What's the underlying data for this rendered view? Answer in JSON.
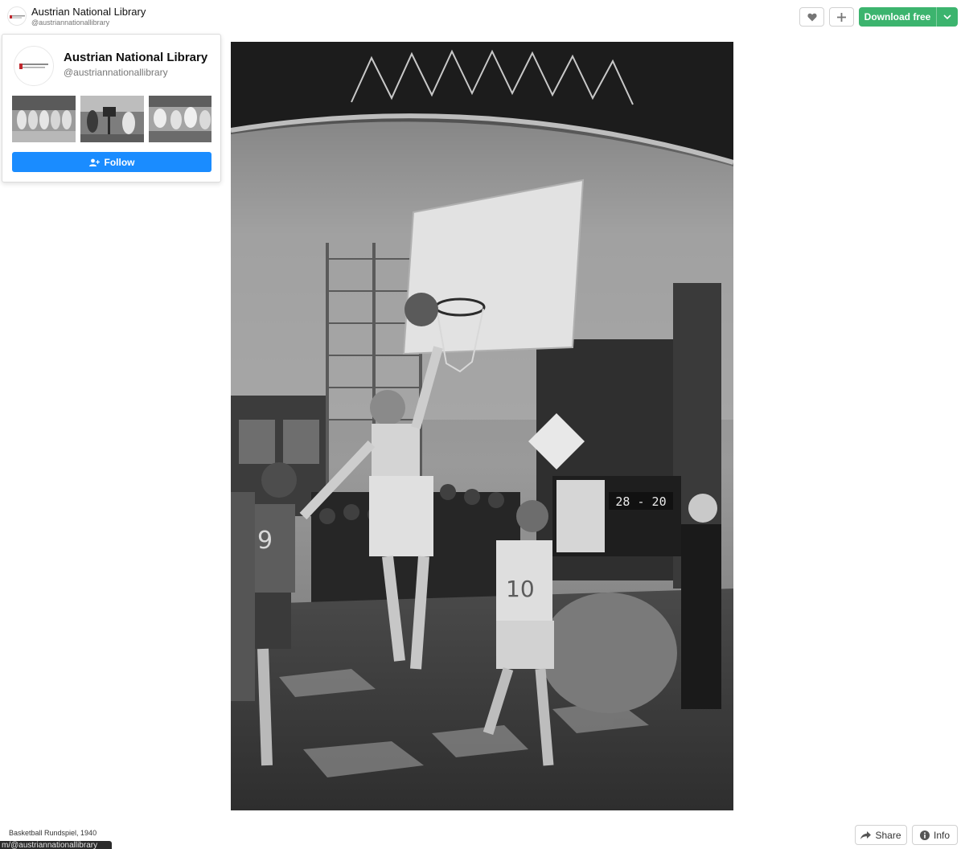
{
  "author": {
    "name": "Austrian National Library",
    "handle": "@austriannationallibrary"
  },
  "toolbar": {
    "download_label": "Download free"
  },
  "profile_card": {
    "name": "Austrian National Library",
    "handle": "@austriannationallibrary",
    "follow_label": "Follow"
  },
  "photo": {
    "scoreboard_score": "28 - 20",
    "jersey_left": "9",
    "jersey_right": "10"
  },
  "footer": {
    "caption": "Basketball Rundspiel, 1940",
    "link_preview": "m/@austriannationallibrary",
    "share_label": "Share",
    "info_label": "Info"
  },
  "colors": {
    "download_green": "#3cb46e",
    "follow_blue": "#1a8cff"
  },
  "icons": [
    "heart-icon",
    "plus-icon",
    "chevron-down-icon",
    "add-user-icon",
    "share-icon",
    "info-icon"
  ]
}
